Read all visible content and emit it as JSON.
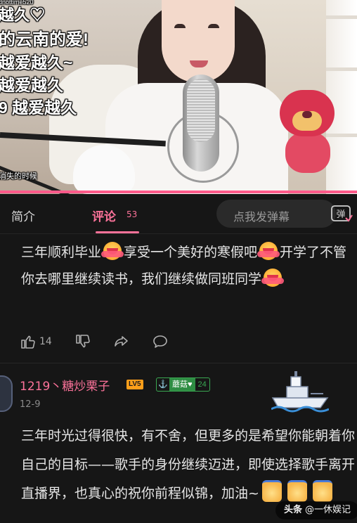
{
  "video": {
    "danmaku": [
      "越久♡",
      "的云南的爱!",
      "越爱越久~",
      "越爱越久",
      "9 越爱越久"
    ],
    "danmaku_user": "dnottime520",
    "danmaku_small": "消失的时候",
    "progress_fraction": 1.0
  },
  "tabs": {
    "intro_label": "简介",
    "comments_label": "评论",
    "comments_count": "53",
    "danmaku_input_placeholder": "点我发弹幕",
    "danmaku_toggle_label": "弹"
  },
  "comments": [
    {
      "text_parts": [
        "三年顺利毕业",
        "享受一个美好的寒假吧",
        "开学了不管你去哪里继续读书，我们继续做同班同学"
      ],
      "emoji": "hug-emoji",
      "likes": "14"
    },
    {
      "username": "1219丶糖炒栗子",
      "level_badge": "LV5",
      "fan_badge_icon": "anchor-icon",
      "fan_badge_name": "蘑菇♥",
      "fan_badge_level": "24",
      "date": "12-9",
      "text": "三年时光过得很快，有不舍，但更多的是希望你能朝着你自己的目标——歌手的身份继续迈进，即使选择歌手离开直播界，也真心的祝你前程似锦，加油~",
      "emoji": "cheer-emoji"
    }
  ],
  "watermark": {
    "brand": "头条",
    "author": "@一休娱记"
  }
}
